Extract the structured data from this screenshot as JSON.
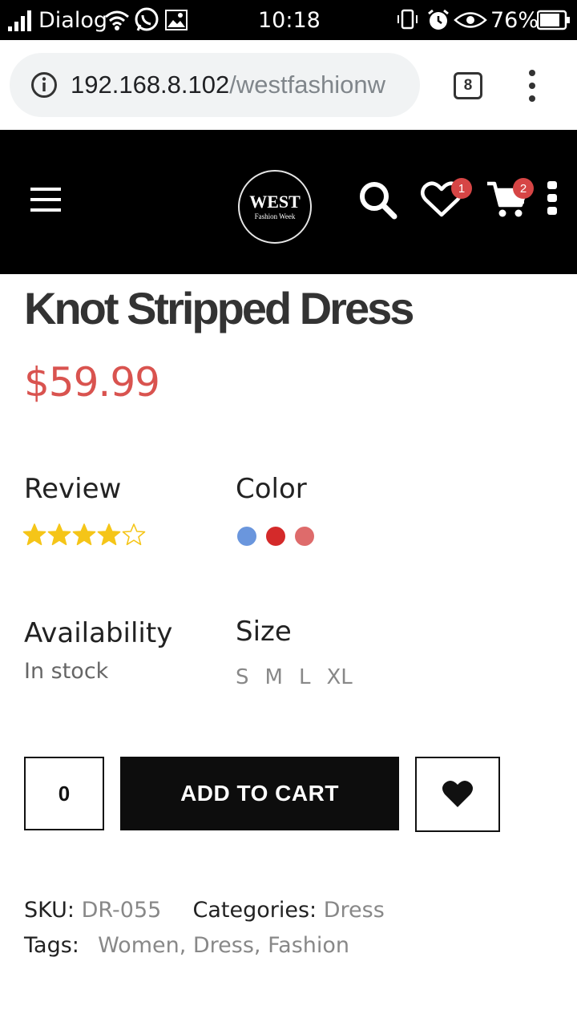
{
  "status_bar": {
    "carrier": "Dialog",
    "time": "10:18",
    "battery": "76%",
    "icons": [
      "signal-icon",
      "wifi-icon",
      "whatsapp-icon",
      "gallery-icon",
      "vibrate-icon",
      "alarm-icon",
      "eye-icon",
      "battery-icon"
    ]
  },
  "browser": {
    "url_host": "192.168.8.102",
    "url_path": "/westfashionw",
    "tab_count": "8"
  },
  "site_header": {
    "logo_main": "WEST",
    "logo_sub": "Fashion Week",
    "wishlist_count": "1",
    "cart_count": "2"
  },
  "product": {
    "title": "Knot Stripped Dress",
    "price": "$59.99",
    "review_label": "Review",
    "rating": 4,
    "rating_max": 5,
    "color_label": "Color",
    "colors": [
      "#6a96dd",
      "#d42a2a",
      "#de6b6b"
    ],
    "availability_label": "Availability",
    "stock_status": "In stock",
    "size_label": "Size",
    "sizes": [
      "S",
      "M",
      "L",
      "XL"
    ],
    "quantity": "0",
    "add_to_cart_label": "ADD TO CART",
    "sku_label": "SKU:",
    "sku_value": "DR-055",
    "categories_label": "Categories:",
    "categories_value": "Dress",
    "tags_label": "Tags:",
    "tags_value": "Women, Dress, Fashion"
  },
  "colors": {
    "price": "#d9534f",
    "badge": "#d64545",
    "star": "#f5c518",
    "header_bg": "#000000"
  }
}
